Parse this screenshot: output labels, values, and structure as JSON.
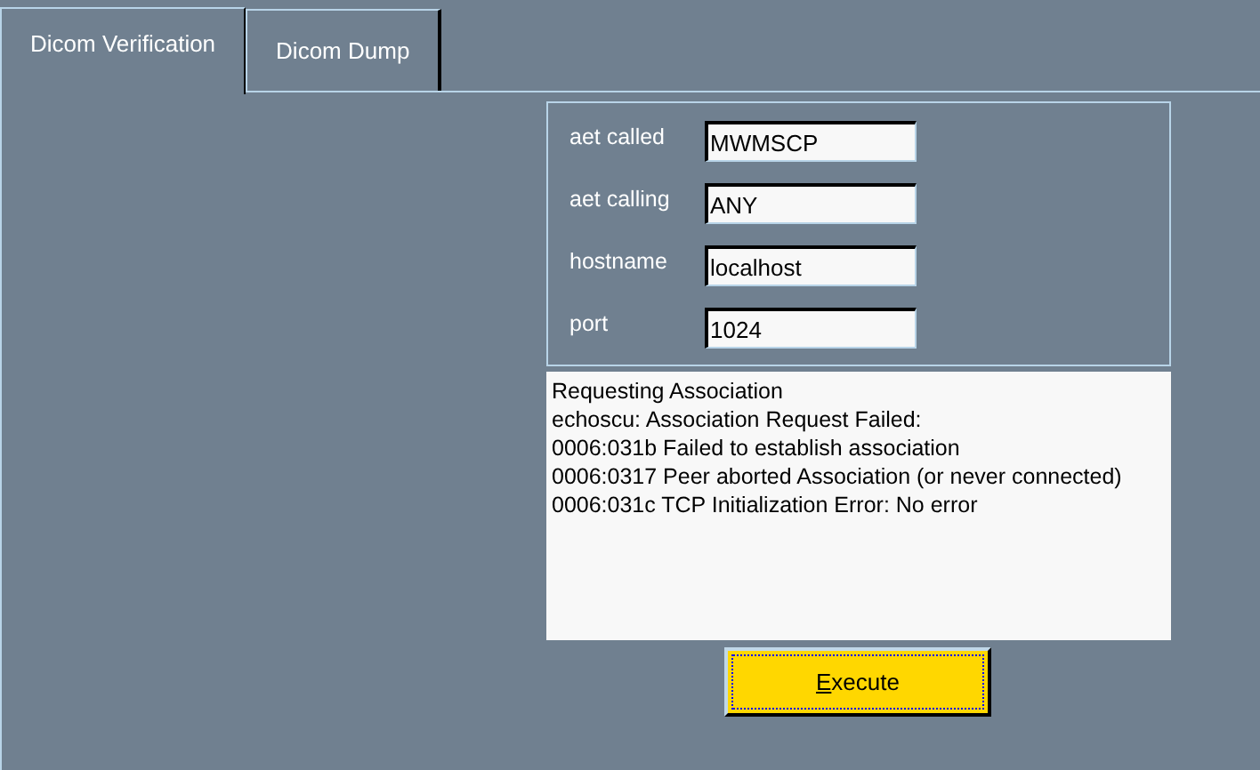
{
  "tabs": [
    {
      "label": "Dicom Verification",
      "selected": true
    },
    {
      "label": "Dicom Dump",
      "selected": false
    }
  ],
  "fields": [
    {
      "label": "aet called",
      "value": "MWMSCP"
    },
    {
      "label": "aet calling",
      "value": "ANY"
    },
    {
      "label": "hostname",
      "value": "localhost"
    },
    {
      "label": "port",
      "value": "1024"
    }
  ],
  "log": [
    "Requesting Association",
    "echoscu: Association Request Failed:",
    "0006:031b Failed to establish association",
    "0006:0317 Peer aborted Association (or never connected)",
    "0006:031c TCP Initialization Error: No error"
  ],
  "execute_button": {
    "label": "Execute",
    "underline_first": true,
    "focused": true
  }
}
